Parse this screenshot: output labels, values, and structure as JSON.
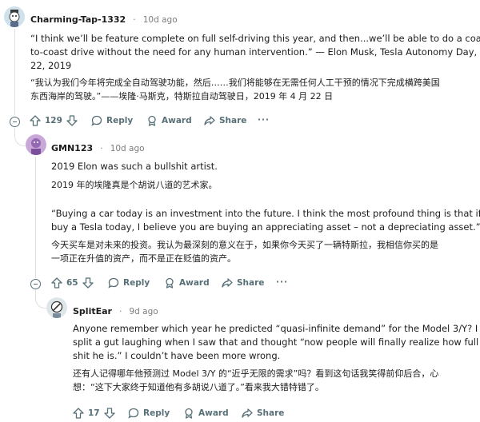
{
  "comments": [
    {
      "author": "Charming-Tap-1332",
      "separator": "·",
      "time": "10d ago",
      "body_en_lines": [
        "“I think we’ll be feature complete on full self-driving this year, and then...we’ll be able to do a coast-",
        "to-coast drive without the need for any human intervention.” — Elon Musk, Tesla Autonomy Day, April",
        "22, 2019"
      ],
      "body_zh_lines": [
        "“我认为我们今年将完成全自动驾驶功能，然后……我们将能够在无需任何人工干预的情况下完成横跨美国",
        "东西海岸的驾驶。”——埃隆·马斯克，特斯拉自动驾驶日，2019 年 4 月 22 日"
      ],
      "score": "129",
      "reply_label": "Reply",
      "award_label": "Award",
      "share_label": "Share",
      "more_label": "···"
    },
    {
      "author": "GMN123",
      "separator": "·",
      "time": "10d ago",
      "p1_en": "2019 Elon was such a bullshit artist.",
      "p1_zh": "2019 年的埃隆真是个胡说八道的艺术家。",
      "p2_en_lines": [
        "“Buying a car today is an investment into the future. I think the most profound thing is that if you",
        "buy a Tesla today, I believe you are buying an appreciating asset – not a depreciating asset.”"
      ],
      "p2_zh_lines": [
        "今天买车是对未来的投资。我认为最深刻的意义在于，如果你今天买了一辆特斯拉，我相信你买的是",
        "一项正在升值的资产，而不是正在贬值的资产。"
      ],
      "score": "65",
      "reply_label": "Reply",
      "award_label": "Award",
      "share_label": "Share",
      "more_label": "···"
    },
    {
      "author": "SplitEar",
      "separator": "·",
      "time": "9d ago",
      "body_en_lines": [
        "Anyone remember which year he predicted “quasi-infinite demand” for the Model 3/Y? I",
        "split a gut laughing when I saw that and thought “now people will finally realize how full of",
        "shit he is.” I couldn’t have been more wrong."
      ],
      "body_zh_lines": [
        "还有人记得哪年他预测过 Model 3/Y 的“近乎无限的需求”吗？看到这句话我笑得前仰后合，心",
        "想：“这下大家终于知道他有多胡说八道了。”看来我大错特错了。"
      ],
      "score": "17",
      "reply_label": "Reply",
      "award_label": "Award",
      "share_label": "Share"
    }
  ]
}
